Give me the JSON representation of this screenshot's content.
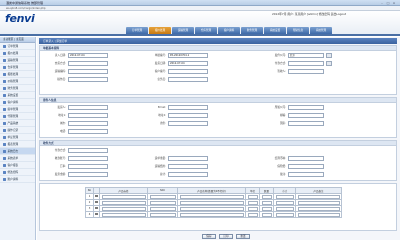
{
  "window": {
    "title": "酒类中通信联系统  佛部管理",
    "address": "ws.sjbn8.com/cargo/index.php"
  },
  "header": {
    "logo": "fenvi",
    "user_line": "2012年7月 用户: 某某用户 [admin]  修改密码  退出Logout"
  },
  "tabs": [
    {
      "label": "订单管理",
      "active": false
    },
    {
      "label": "报价处理",
      "active": true
    },
    {
      "label": "运输管理",
      "active": false
    },
    {
      "label": "仓库管理",
      "active": false
    },
    {
      "label": "客户资料",
      "active": false
    },
    {
      "label": "财务管理",
      "active": false
    },
    {
      "label": "系统设置",
      "active": false
    },
    {
      "label": "帮助信息",
      "active": false
    },
    {
      "label": "系统管理",
      "active": false
    }
  ],
  "sidebar": {
    "header": "主功能区 | 主页面",
    "items": [
      "订单管理",
      "报价处理",
      "运输管理",
      "仓库管理",
      "报账处理",
      "价格管理",
      "财务管理",
      "系统设置",
      "客户资料",
      "提单管理",
      "代理管理",
      "产品系统",
      "操作记录",
      "单证管理",
      "报表管理",
      "系统日志",
      "系统表单",
      "客户报表",
      "修改密码",
      "账户资料"
    ]
  },
  "main": {
    "breadcrumb": "订单录入 | 添加订单",
    "sections": {
      "basic": "单据基本资料",
      "sender": "寄件人信息",
      "pay": "收件方式"
    },
    "basic_fields": {
      "l_date": "录入日期:",
      "v_date": "2012-07-04",
      "l_no": "单据编号:",
      "v_no": "PX-20120704-1",
      "l_addr": "发件公司:",
      "v_addr": "北京",
      "l_type": "交货方式:",
      "l_ship": "发货日期:",
      "v_ship": "2012-07-04",
      "l_pay": "付款方式:",
      "l_code": "运输编码:",
      "l_cust": "客户编号:",
      "l_rec": "签收人:",
      "l_opr": "操作员:",
      "l_sales": "业务员:"
    },
    "sender_fields": {
      "l_name": "发货人:",
      "l_email": "Email:",
      "l_company": "所属公司:",
      "l_addr2": "地址1:",
      "l_addr3": "地址2:",
      "l_zip": "邮编:",
      "l_city": "城市:",
      "l_state": "省份:",
      "l_country": "国家:",
      "l_tel": "电话:"
    },
    "pay_fields": {
      "l_pay_type": "付款方式:",
      "l_account": "收款账号:",
      "l_weight": "运单重量:",
      "l_currency": "结算币种:",
      "l_rate": "汇率:",
      "l_fee": "运输费用:",
      "l_insure": "保险费:",
      "l_total": "总计:",
      "l_inv": "发票金额:",
      "l_note": "备注:"
    },
    "items_table": {
      "headers": [
        "No",
        "",
        "产品标签",
        "SKU",
        "产品名称(数量为0不打印)",
        "单位",
        "数量",
        "小计",
        "产品备注"
      ],
      "rows": [
        "1",
        "2",
        "3",
        "4"
      ]
    },
    "buttons": {
      "save": "保存",
      "print": "打印",
      "reset": "重置"
    }
  }
}
